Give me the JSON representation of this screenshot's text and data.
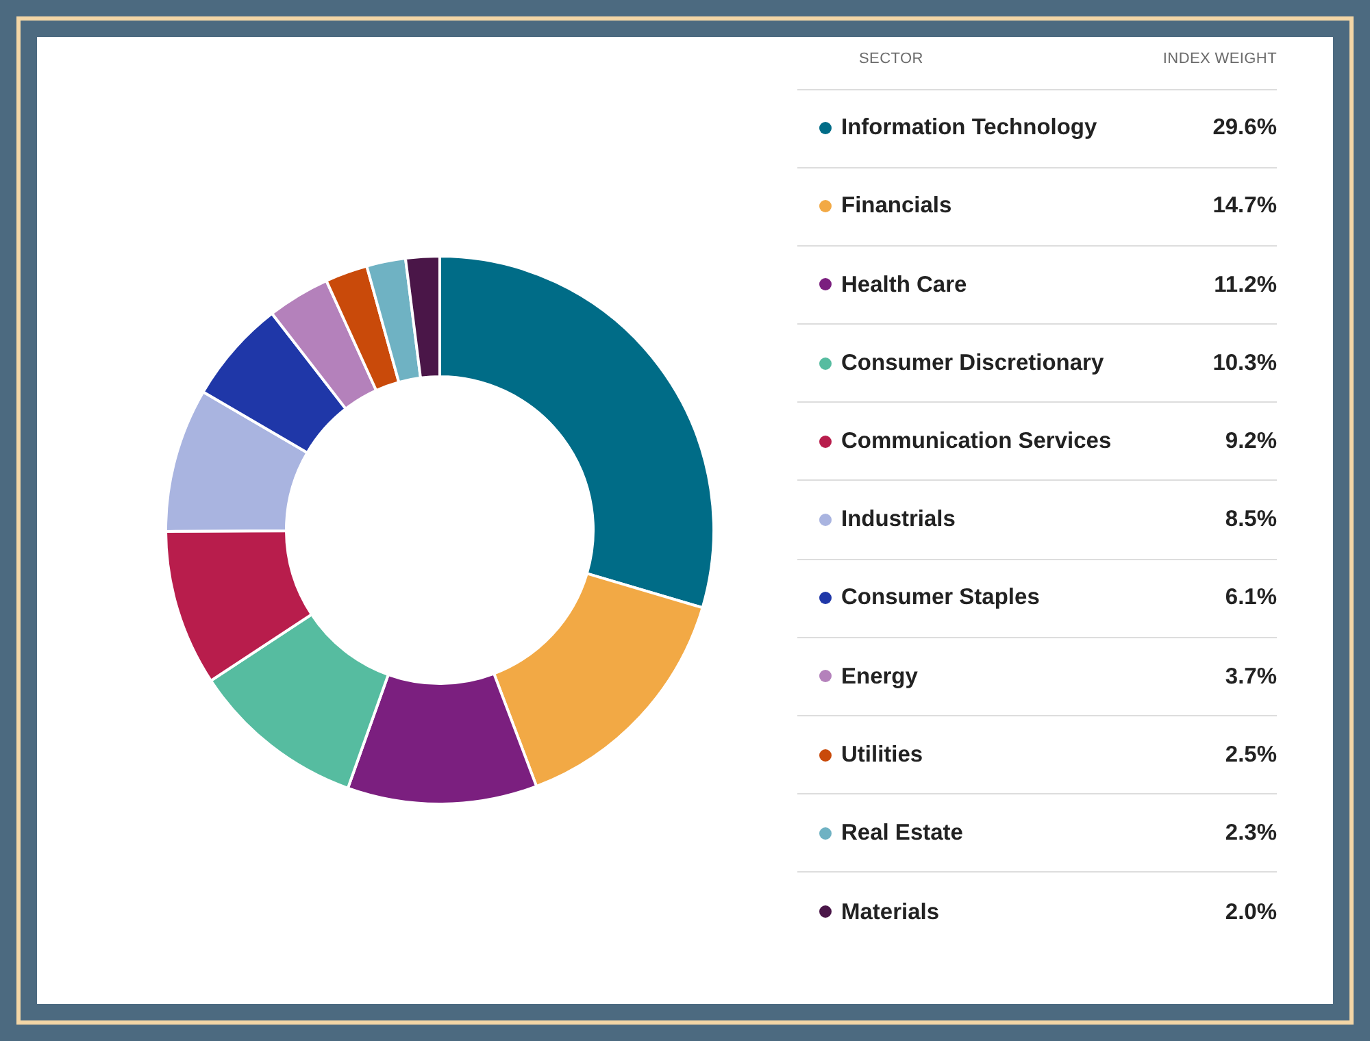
{
  "chart": {
    "chart_data": {
      "type": "donut",
      "values": [
        29.6,
        14.7,
        11.2,
        10.3,
        9.2,
        8.5,
        6.1,
        3.7,
        2.5,
        2.3,
        2.0
      ]
    }
  },
  "table": {
    "columns": [
      "SECTOR",
      "INDEX WEIGHT"
    ],
    "rows": [
      {
        "sector": "Information Technology",
        "weight": "29.6%",
        "color": "#006c87"
      },
      {
        "sector": "Financials",
        "weight": "14.7%",
        "color": "#f2a945"
      },
      {
        "sector": "Health Care",
        "weight": "11.2%",
        "color": "#7b1f7f"
      },
      {
        "sector": "Consumer Discretionary",
        "weight": "10.3%",
        "color": "#56bca0"
      },
      {
        "sector": "Communication Services",
        "weight": "9.2%",
        "color": "#b81d4c"
      },
      {
        "sector": "Industrials",
        "weight": "8.5%",
        "color": "#a9b4e0"
      },
      {
        "sector": "Consumer Staples",
        "weight": "6.1%",
        "color": "#1f37a8"
      },
      {
        "sector": "Energy",
        "weight": "3.7%",
        "color": "#b481bb"
      },
      {
        "sector": "Utilities",
        "weight": "2.5%",
        "color": "#c94a0a"
      },
      {
        "sector": "Real Estate",
        "weight": "2.3%",
        "color": "#6fb2c3"
      },
      {
        "sector": "Materials",
        "weight": "2.0%",
        "color": "#4a1648"
      }
    ]
  }
}
